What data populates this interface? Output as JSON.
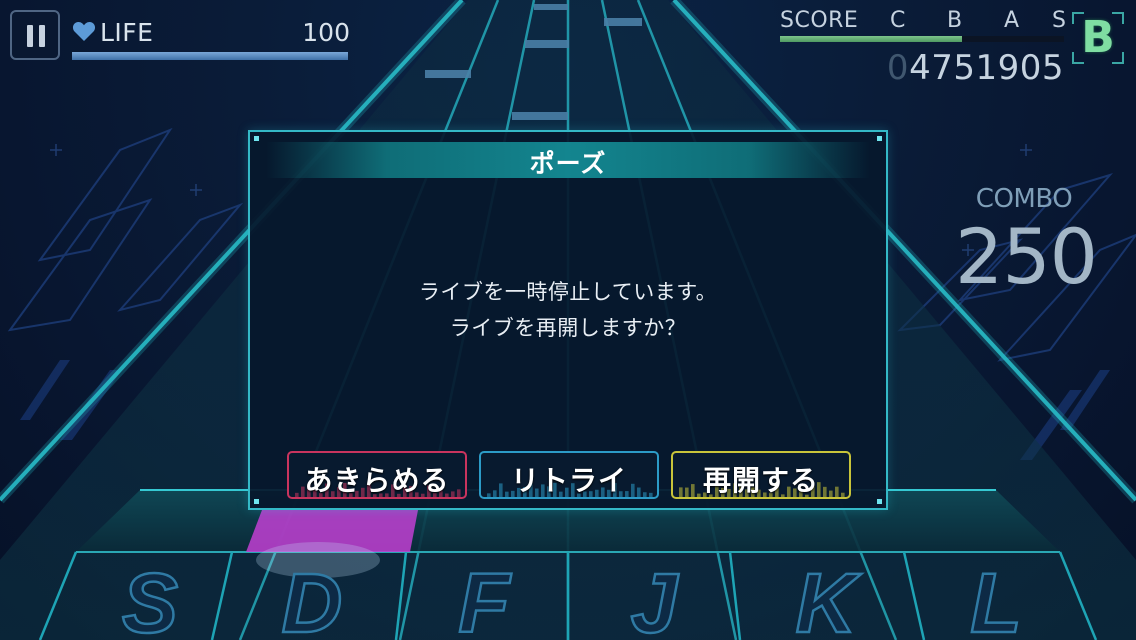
{
  "hud": {
    "life_label": "LIFE",
    "life_value": "100",
    "life_fraction": 1.0,
    "score_label": "SCORE",
    "score_ranks": [
      "C",
      "B",
      "A",
      "S"
    ],
    "score_progress_fraction": 0.64,
    "score_leading_zero": "0",
    "score_digits": "4751905",
    "rank": "B",
    "colors": {
      "life_bar": "#5b8cc4",
      "score_bar": "#6bb67a",
      "rank_letter": "#7fdda2"
    }
  },
  "combo": {
    "label": "COMBO",
    "value": "250"
  },
  "lanes": {
    "keys": [
      "S",
      "D",
      "F",
      "J",
      "K",
      "L"
    ]
  },
  "dialog": {
    "title": "ポーズ",
    "message_line1": "ライブを一時停止しています。",
    "message_line2": "ライブを再開しますか？",
    "buttons": {
      "give_up": "あきらめる",
      "retry": "リトライ",
      "resume": "再開する"
    },
    "colors": {
      "give_up": "#c9345e",
      "retry": "#2c9bc7",
      "resume": "#c8c43a",
      "frame": "#34b9c7"
    }
  },
  "icons": {
    "pause": "pause-icon",
    "life": "heart-icon"
  }
}
